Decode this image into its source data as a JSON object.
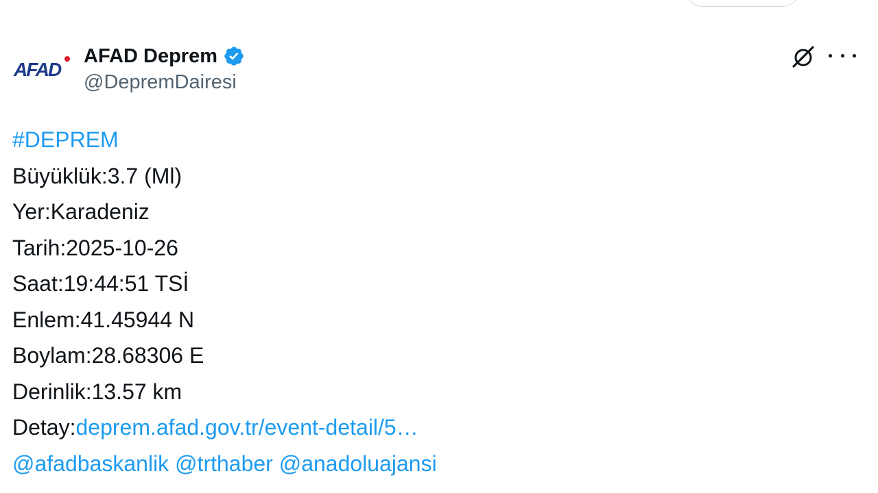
{
  "author": {
    "display_name": "AFAD Deprem",
    "handle": "@DepremDairesi",
    "avatar_text": "AFAD",
    "verified": true
  },
  "colors": {
    "link": "#1d9bf0",
    "text": "#0f1419",
    "secondary": "#536471",
    "verified_badge": "#1d9bf0",
    "avatar_blue": "#1f3a8a",
    "avatar_red": "#e11d2a"
  },
  "icons": {
    "verified": "verified-badge-icon",
    "grok": "grok-icon",
    "more": "more-options-icon"
  },
  "tweet": {
    "hashtag": "#DEPREM",
    "lines": [
      "Büyüklük:3.7 (Ml)",
      "Yer:Karadeniz",
      "Tarih:2025-10-26",
      "Saat:19:44:51 TSİ",
      "Enlem:41.45944 N",
      "Boylam:28.68306 E",
      "Derinlik:13.57 km"
    ],
    "detail_label": "Detay:",
    "detail_link": "deprem.afad.gov.tr/event-detail/5…",
    "mentions": [
      "@afadbaskanlik",
      "@trthaber",
      "@anadoluajansi"
    ]
  }
}
